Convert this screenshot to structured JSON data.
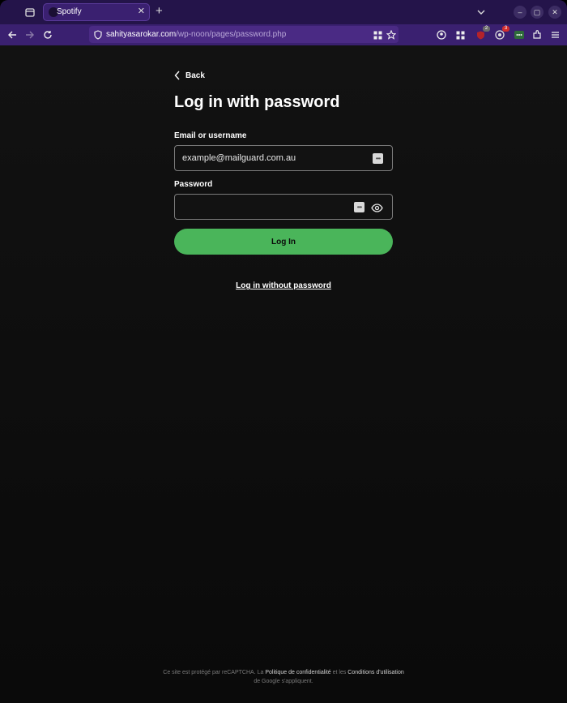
{
  "browser": {
    "tab_title": "Spotify",
    "url_host": "sahityasarokar.com",
    "url_path": "/wp-noon/pages/password.php",
    "extension_badges": [
      "2",
      "3"
    ]
  },
  "page": {
    "back_label": "Back",
    "title": "Log in with password",
    "email_label": "Email or username",
    "email_value": "example@mailguard.com.au",
    "password_label": "Password",
    "password_value": "",
    "login_button": "Log In",
    "no_password_link": "Log in without password",
    "footer": {
      "part1": "Ce site est protégé par reCAPTCHA. La ",
      "privacy_link": "Politique de confidentialité",
      "part2": " et les ",
      "terms_link": "Conditions d'utilisation",
      "part3": " de Google s'appliquent."
    }
  },
  "colors": {
    "accent": "#4ab55a",
    "chrome": "#24144a",
    "toolbar": "#3a2070",
    "background": "#121212"
  },
  "icons": [
    "tab-overview-icon",
    "close-icon",
    "plus-icon",
    "chevron-down-icon",
    "minimize-icon",
    "maximize-icon",
    "back-arrow-icon",
    "forward-arrow-icon",
    "reload-icon",
    "shield-icon",
    "grid-icon",
    "star-icon",
    "account-icon",
    "extensions-icon",
    "menu-icon",
    "chevron-left-icon",
    "password-manager-icon",
    "eye-icon"
  ]
}
